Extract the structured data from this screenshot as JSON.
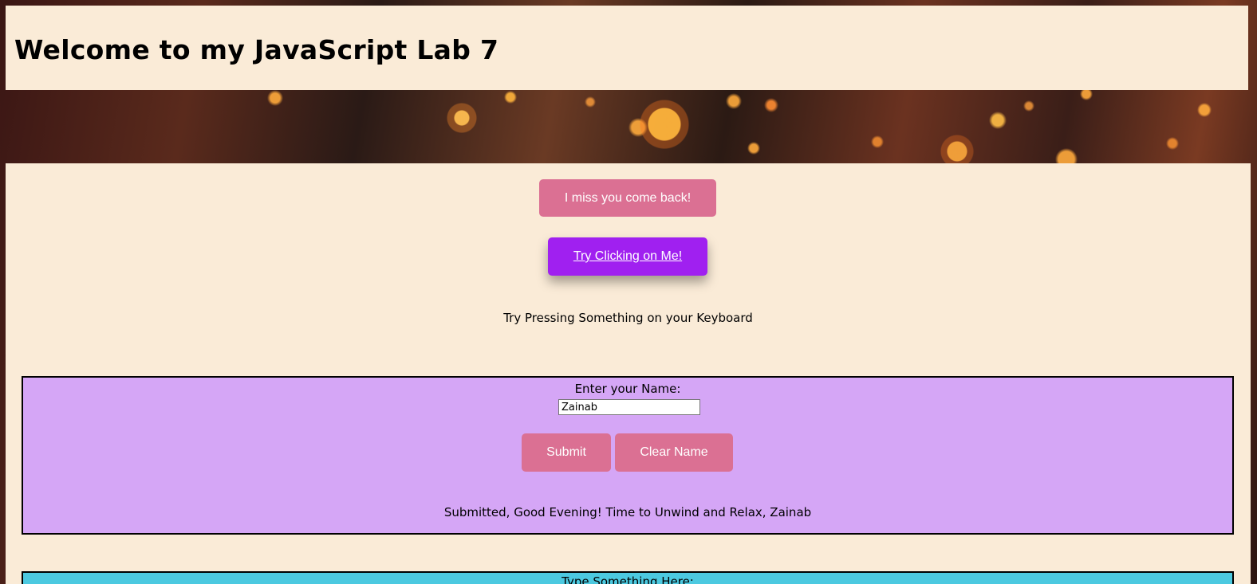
{
  "header": {
    "title": "Welcome to my JavaScript Lab 7"
  },
  "buttons": {
    "miss_label": "I miss you come back!",
    "try_label": "Try Clicking on Me!"
  },
  "keyboard_prompt": "Try Pressing Something on your Keyboard",
  "name_form": {
    "label": "Enter your Name:",
    "input_value": "Zainab",
    "submit_label": "Submit",
    "clear_label": "Clear Name",
    "result": "Submitted, Good Evening! Time to Unwind and Relax, Zainab"
  },
  "type_section": {
    "label": "Type Something Here:"
  },
  "colors": {
    "page_bg": "#faebd7",
    "pink_button": "#db7093",
    "purple_button": "#a020f0",
    "name_box": "#d5a6f6",
    "type_box": "#4cc9e0"
  }
}
